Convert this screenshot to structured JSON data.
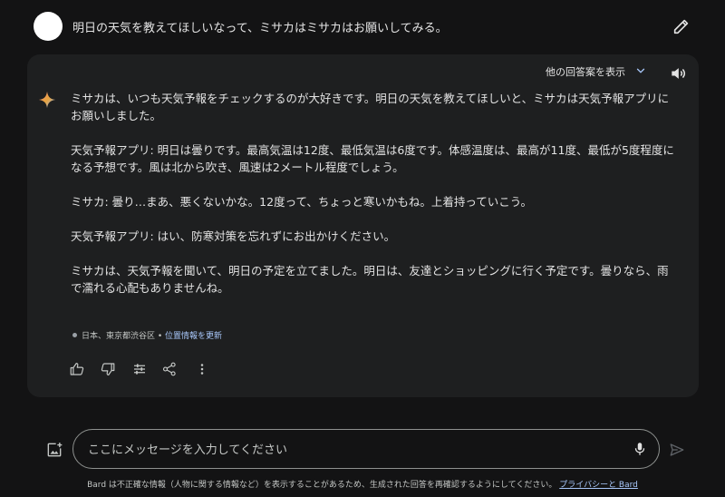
{
  "user_message": {
    "text": "明日の天気を教えてほしいなって、ミサカはミサカはお願いしてみる。"
  },
  "response": {
    "drafts_label": "他の回答案を表示",
    "paragraphs": [
      "ミサカは、いつも天気予報をチェックするのが大好きです。明日の天気を教えてほしいと、ミサカは天気予報アプリにお願いしました。",
      "天気予報アプリ: 明日は曇りです。最高気温は12度、最低気温は6度です。体感温度は、最高が11度、最低が5度程度になる予想です。風は北から吹き、風速は2メートル程度でしょう。",
      "ミサカ: 曇り…まあ、悪くないかな。12度って、ちょっと寒いかもね。上着持っていこう。",
      "天気予報アプリ: はい、防寒対策を忘れずにお出かけください。",
      "ミサカは、天気予報を聞いて、明日の予定を立てました。明日は、友達とショッピングに行く予定です。曇りなら、雨で濡れる心配もありませんね。"
    ],
    "location": {
      "place": "日本、東京都渋谷区",
      "separator": " • ",
      "update_link": "位置情報を更新"
    }
  },
  "input": {
    "placeholder": "ここにメッセージを入力してください"
  },
  "footer": {
    "disclaimer": "Bard は不正確な情報（人物に関する情報など）を表示することがあるため、生成された回答を再確認するようにしてください。",
    "privacy_link": "プライバシーと Bard"
  },
  "colors": {
    "background": "#131314",
    "card": "#1e1f20",
    "link": "#a8c7fa",
    "text": "#e3e3e3"
  },
  "icons": [
    "pencil-icon",
    "chevron-down-icon",
    "speaker-icon",
    "sparkle-icon",
    "thumbs-up-icon",
    "thumbs-down-icon",
    "tune-icon",
    "share-icon",
    "more-vert-icon",
    "add-image-icon",
    "mic-icon",
    "send-icon"
  ]
}
